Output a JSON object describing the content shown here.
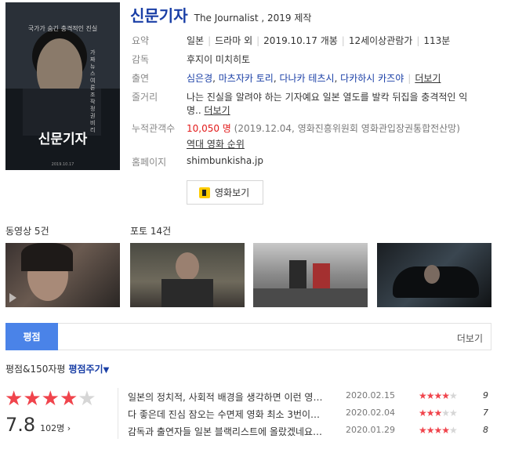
{
  "poster": {
    "title": "신문기자",
    "tagline": "국가가 숨긴 충격적인 진실",
    "vertical_text": "가짜 뉴스 여론 조작 정권 비리",
    "date_text": "2019.10.17"
  },
  "movie": {
    "title_ko": "신문기자",
    "title_sub": "The Journalist , 2019 제작"
  },
  "info": {
    "summary_label": "요약",
    "country": "일본",
    "genre": "드라마 외",
    "release": "2019.10.17 개봉",
    "rating": "12세이상관람가",
    "runtime": "113분",
    "director_label": "감독",
    "director": "후지이 미치히토",
    "cast_label": "출연",
    "cast": [
      "심은경",
      "마츠자카 토리",
      "다나카 테츠시",
      "다카하시 카즈야"
    ],
    "cast_more": "더보기",
    "plot_label": "줄거리",
    "plot_line1": "나는 진실을 알려야 하는 기자예요 일본 열도를 발칵 뒤집을 충격적인 익",
    "plot_line2": "명..",
    "plot_more": "더보기",
    "audience_label": "누적관객수",
    "audience_count": "10,050 명",
    "audience_source": "(2019.12.04, 영화진흥위원회 영화관입장권통합전산망)",
    "boxoffice_link": "역대 영화 순위",
    "homepage_label": "홈페이지",
    "homepage": "shimbunkisha.jp"
  },
  "watch_button": {
    "label": "영화보기"
  },
  "videos": {
    "label": "동영상 5건"
  },
  "photos": {
    "label": "포토 14건"
  },
  "tabs": {
    "active": "평점",
    "more": "더보기"
  },
  "rating": {
    "head": "평점&150자평",
    "give_label": "평점주기",
    "score": "7.8",
    "count": "102명 ›",
    "stars_filled": 4,
    "stars_total": 5,
    "colors": {
      "star_on": "#f0444c",
      "star_off": "#d6d6d6"
    }
  },
  "reviews": [
    {
      "text": "일본의 정치적, 사회적 배경을 생각하면 이런 영…",
      "date": "2020.02.15",
      "score": "9",
      "stars": 4.5
    },
    {
      "text": "다 좋은데 진심 잠오는 수면제 영화 최소 3번이…",
      "date": "2020.02.04",
      "score": "7",
      "stars": 3.5
    },
    {
      "text": "감독과 출연자들 일본 블랙리스트에 올랐겠네요…",
      "date": "2020.01.29",
      "score": "8",
      "stars": 4
    }
  ]
}
